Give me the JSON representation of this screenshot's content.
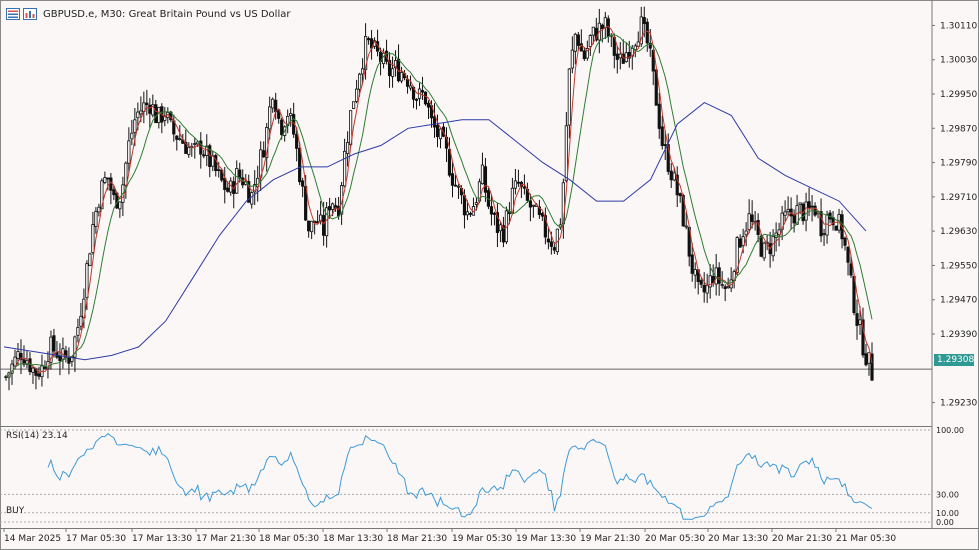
{
  "header": {
    "symbol_line": "GBPUSD.e, M30:  Great Britain Pound vs US Dollar"
  },
  "indicator": {
    "rsi_label": "RSI(14) 23.14",
    "rsi_levels": [
      "100.00",
      "30.00",
      "10.00",
      "0.00"
    ]
  },
  "signal": {
    "label": "BUY"
  },
  "price_axis": {
    "labels": [
      "1.30110",
      "1.30030",
      "1.29950",
      "1.29870",
      "1.29790",
      "1.29710",
      "1.29630",
      "1.29550",
      "1.29470",
      "1.29390",
      "1.29230"
    ],
    "current_price": "1.29308"
  },
  "time_axis": {
    "labels": [
      "14 Mar 2025",
      "17 Mar 05:30",
      "17 Mar 13:30",
      "17 Mar 21:30",
      "18 Mar 05:30",
      "18 Mar 13:30",
      "18 Mar 21:30",
      "19 Mar 05:30",
      "19 Mar 13:30",
      "19 Mar 21:30",
      "20 Mar 05:30",
      "20 Mar 13:30",
      "20 Mar 21:30",
      "21 Mar 05:30"
    ]
  },
  "colors": {
    "background": "#fcf7f7",
    "candle": "#111111",
    "ma_fast": "#c0392b",
    "ma_mid": "#2e7d32",
    "ma_slow": "#2c3aa8",
    "rsi_line": "#3d9ad6",
    "price_tag": "#2f9a94"
  },
  "chart_data": {
    "type": "candlestick",
    "timeframe": "M30",
    "ylim": [
      1.2918,
      1.3016
    ],
    "current_price": 1.29308,
    "close_path": [
      1.2929,
      1.2932,
      1.2935,
      1.2933,
      1.293,
      1.2931,
      1.2936,
      1.2935,
      1.2933,
      1.2934,
      1.2941,
      1.2952,
      1.2964,
      1.2972,
      1.2976,
      1.297,
      1.2972,
      1.2983,
      1.299,
      1.2992,
      1.2993,
      1.2989,
      1.2991,
      1.2986,
      1.2985,
      1.2983,
      1.2981,
      1.2983,
      1.298,
      1.2977,
      1.2974,
      1.2972,
      1.2976,
      1.2975,
      1.2971,
      1.2978,
      1.2985,
      1.2997,
      1.2987,
      1.2991,
      1.2985,
      1.2973,
      1.2963,
      1.2966,
      1.2963,
      1.2971,
      1.2968,
      1.2982,
      1.2993,
      1.3001,
      1.3007,
      1.3005,
      1.3003,
      1.3,
      1.3001,
      1.3,
      1.2998,
      1.2994,
      1.2995,
      1.2988,
      1.2985,
      1.2981,
      1.2975,
      1.2971,
      1.2967,
      1.297,
      1.2976,
      1.2968,
      1.2964,
      1.2963,
      1.2971,
      1.2974,
      1.297,
      1.2968,
      1.2965,
      1.2962,
      1.296,
      1.2967,
      1.2999,
      1.301,
      1.3003,
      1.3008,
      1.301,
      1.3011,
      1.3006,
      1.3002,
      1.3005,
      1.3008,
      1.3011,
      1.3006,
      1.2995,
      1.2983,
      1.2978,
      1.2972,
      1.2965,
      1.2955,
      1.2948,
      1.2949,
      1.2953,
      1.2951,
      1.2949,
      1.2957,
      1.2963,
      1.2966,
      1.2962,
      1.2958,
      1.296,
      1.2963,
      1.2966,
      1.2967,
      1.2968,
      1.2967,
      1.2969,
      1.2964,
      1.2967,
      1.2966,
      1.2962,
      1.2951,
      1.2942,
      1.2935,
      1.293
    ],
    "ma_slow": [
      1.2936,
      1.2935,
      1.2934,
      1.2933,
      1.2934,
      1.2936,
      1.2942,
      1.2952,
      1.2962,
      1.297,
      1.2975,
      1.2978,
      1.2978,
      1.2981,
      1.2983,
      1.2987,
      1.2988,
      1.2989,
      1.2989,
      1.2984,
      1.2979,
      1.2975,
      1.297,
      1.297,
      1.2975,
      1.2988,
      1.2993,
      1.299,
      1.298,
      1.2976,
      1.2973,
      1.297,
      1.2963
    ],
    "rsi_period": 14,
    "rsi_value": 23.14,
    "rsi_levels": [
      0,
      10,
      30,
      100
    ]
  }
}
